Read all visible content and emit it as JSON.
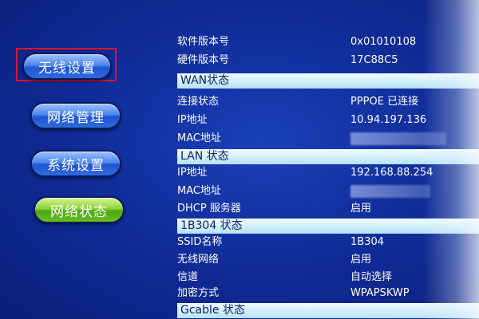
{
  "nav": {
    "wireless": "无线设置",
    "network": "网络管理",
    "system": "系统设置",
    "status": "网络状态"
  },
  "info": {
    "software_version_label": "软件版本号",
    "software_version_value": "0x01010108",
    "hardware_version_label": "硬件版本号",
    "hardware_version_value": "17C88C5",
    "wan_header": "WAN状态",
    "wan_conn_label": "连接状态",
    "wan_conn_value": "PPPOE 已连接",
    "wan_ip_label": "IP地址",
    "wan_ip_value": "10.94.197.136",
    "wan_mac_label": "MAC地址",
    "lan_header": "LAN 状态",
    "lan_ip_label": "IP地址",
    "lan_ip_value": "192.168.88.254",
    "lan_mac_label": "MAC地址",
    "dhcp_label": "DHCP 服务器",
    "dhcp_value": "启用",
    "wifi_header": "1B304 状态",
    "ssid_label": "SSID名称",
    "ssid_value": "1B304",
    "wireless_label": "无线网络",
    "wireless_value": "启用",
    "channel_label": "信道",
    "channel_value": "自动选择",
    "encryption_label": "加密方式",
    "encryption_value": "WPAPSKWP",
    "gcable_header": "Gcable 状态"
  }
}
